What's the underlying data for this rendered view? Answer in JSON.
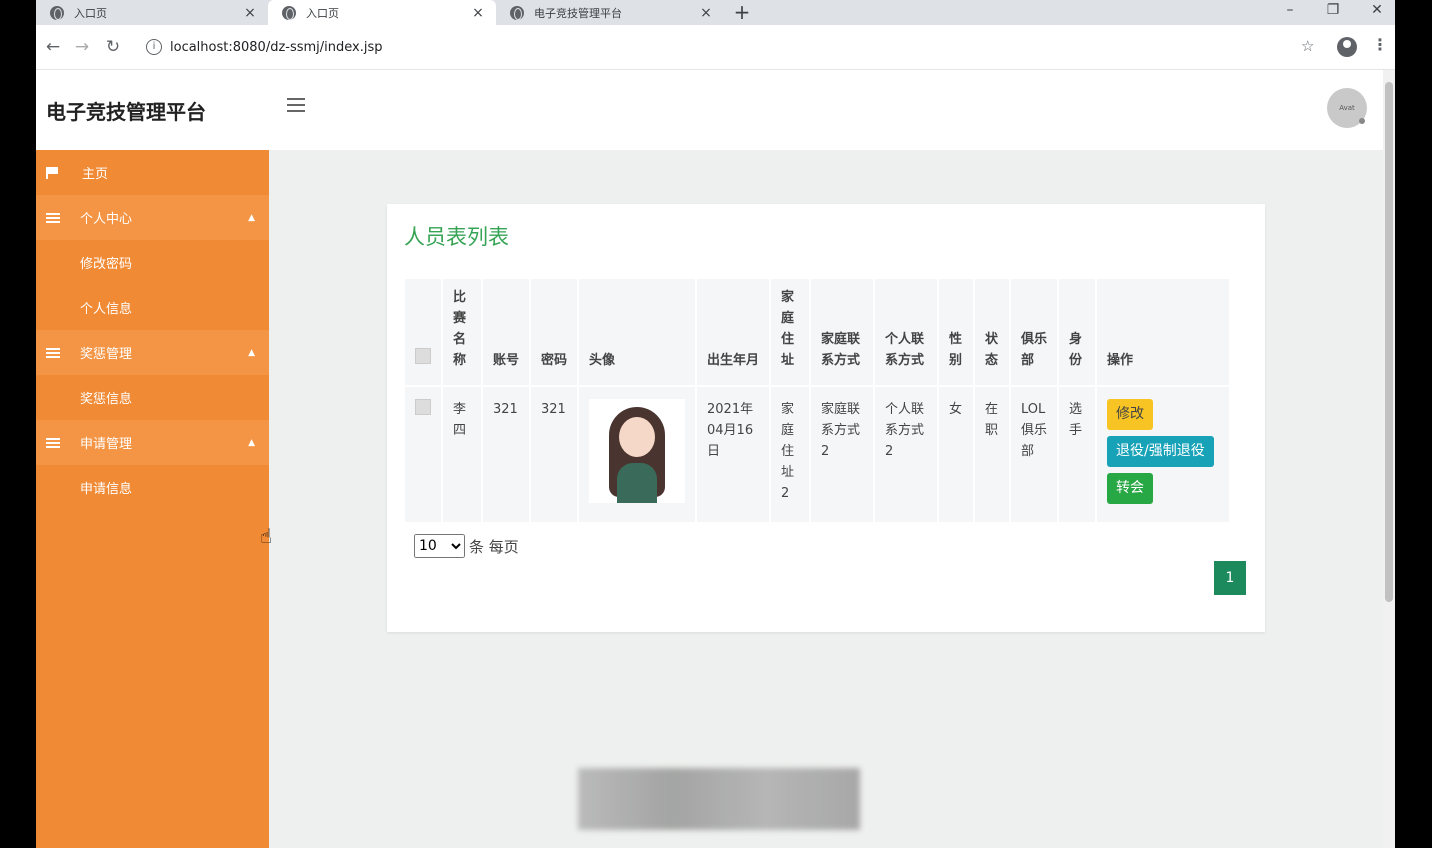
{
  "browser": {
    "tabs": [
      {
        "title": "入口页",
        "close": "×"
      },
      {
        "title": "入口页",
        "close": "×"
      },
      {
        "title": "电子竞技管理平台",
        "close": "×"
      }
    ],
    "new_tab": "+",
    "window_controls": {
      "minimize": "–",
      "restore": "❐",
      "close": "✕"
    },
    "url": "localhost:8080/dz-ssmj/index.jsp",
    "nav": {
      "back": "←",
      "forward": "→",
      "reload": "↻",
      "info": "i",
      "star": "☆",
      "menu": "⋮"
    }
  },
  "header": {
    "brand": "电子竞技管理平台",
    "avatar_text": "Avat"
  },
  "sidebar": {
    "items": [
      {
        "label": "主页",
        "icon": "flag-icon",
        "type": "item"
      },
      {
        "label": "个人中心",
        "icon": "list-icon",
        "type": "group",
        "caret": "▲"
      },
      {
        "label": "修改密码",
        "type": "sub"
      },
      {
        "label": "个人信息",
        "type": "sub"
      },
      {
        "label": "奖惩管理",
        "icon": "list-icon",
        "type": "group",
        "caret": "▲"
      },
      {
        "label": "奖惩信息",
        "type": "sub"
      },
      {
        "label": "申请管理",
        "icon": "list-icon",
        "type": "group",
        "caret": "▲"
      },
      {
        "label": "申请信息",
        "type": "sub"
      }
    ]
  },
  "main": {
    "card_title": "人员表列表",
    "table": {
      "headers": [
        "比赛名称",
        "账号",
        "密码",
        "头像",
        "出生年月",
        "家庭住址",
        "家庭联系方式",
        "个人联系方式",
        "性别",
        "状态",
        "俱乐部",
        "身份",
        "操作"
      ],
      "rows": [
        {
          "name": "李四",
          "account": "321",
          "password": "321",
          "birth": "2021年04月16日",
          "address": "家庭住址2",
          "family_contact": "家庭联系方式2",
          "personal_contact": "个人联系方式2",
          "gender": "女",
          "status": "在职",
          "club": "LOL俱乐部",
          "identity": "选手",
          "actions": {
            "edit": "修改",
            "retire": "退役/强制退役",
            "transfer": "转会"
          }
        }
      ]
    },
    "pager": {
      "page_size": "10",
      "page_size_suffix": "条 每页",
      "current_page": "1"
    }
  },
  "colors": {
    "sidebar": "#f08a34",
    "title_green": "#36a355",
    "edit_btn": "#f7c423",
    "retire_btn": "#17a2b8",
    "transfer_btn": "#28a745",
    "page_btn": "#1c8a5c"
  }
}
